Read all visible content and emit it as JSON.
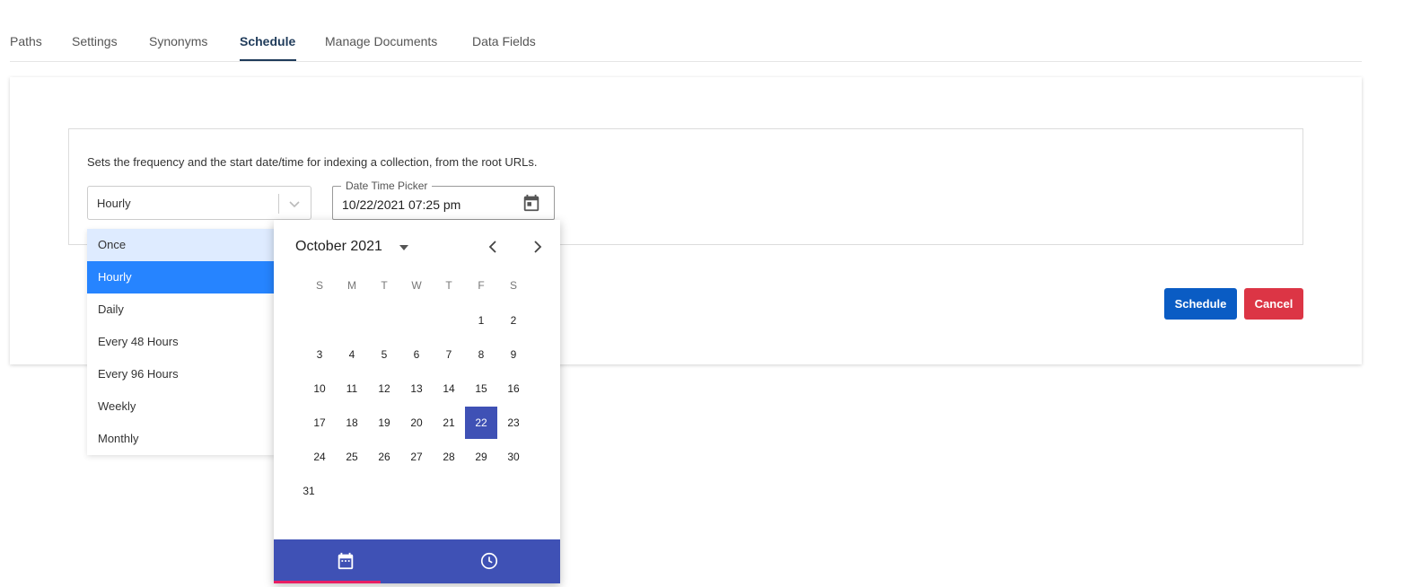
{
  "tabs": [
    {
      "label": "Paths"
    },
    {
      "label": "Settings"
    },
    {
      "label": "Synonyms"
    },
    {
      "label": "Schedule",
      "active": true
    },
    {
      "label": "Manage Documents"
    },
    {
      "label": "Data Fields"
    }
  ],
  "schedule": {
    "description": "Sets the frequency and the start date/time for indexing a collection, from the root URLs.",
    "frequency_value": "Hourly",
    "frequency_options": [
      "Once",
      "Hourly",
      "Daily",
      "Every 48 Hours",
      "Every 96 Hours",
      "Weekly",
      "Monthly"
    ],
    "datetime_label": "Date Time Picker",
    "datetime_value": "10/22/2021 07:25 pm",
    "schedule_button": "Schedule",
    "cancel_button": "Cancel"
  },
  "calendar": {
    "month_label": "October 2021",
    "weekdays": [
      "S",
      "M",
      "T",
      "W",
      "T",
      "F",
      "S"
    ],
    "first_weekday_index": 5,
    "days_in_month": 31,
    "selected_day": 22
  },
  "colors": {
    "accent": "#3f51b5",
    "indicator": "#e91e63",
    "schedule_btn": "#0a5cc4",
    "cancel_btn": "#dc3545",
    "option_selected": "#2684ff",
    "option_focused": "#deebff"
  },
  "icons": {
    "select_chevron": "chevron-down-icon",
    "datetime": "calendar-icon",
    "month_dropdown": "caret-down-icon",
    "prev": "chevron-left-icon",
    "next": "chevron-right-icon",
    "date_tab": "calendar-icon",
    "time_tab": "clock-icon"
  }
}
